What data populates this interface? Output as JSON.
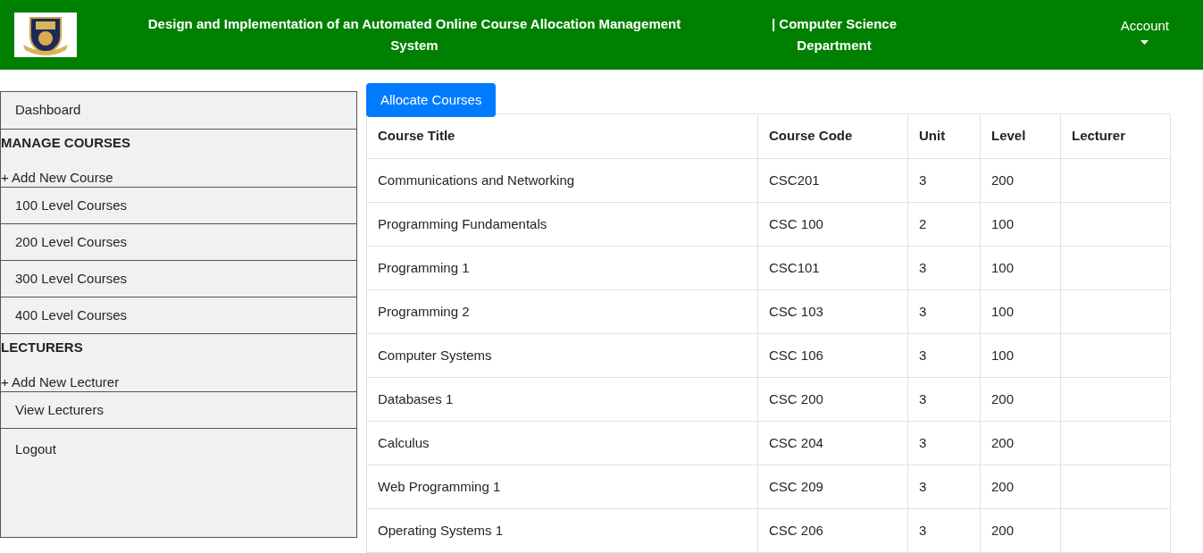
{
  "header": {
    "title": "Design and Implementation of an Automated Online Course Allocation Management System",
    "department": "| Computer Science Department",
    "account": "Account"
  },
  "sidebar": {
    "items": [
      {
        "kind": "link",
        "label": "Dashboard"
      },
      {
        "kind": "section",
        "label": "MANAGE COURSES",
        "add": "+ Add New Course"
      },
      {
        "kind": "link",
        "label": "100 Level Courses"
      },
      {
        "kind": "link",
        "label": "200 Level Courses"
      },
      {
        "kind": "link",
        "label": "300 Level Courses"
      },
      {
        "kind": "link",
        "label": "400 Level Courses"
      },
      {
        "kind": "section",
        "label": "LECTURERS",
        "add": "+ Add New Lecturer"
      },
      {
        "kind": "link",
        "label": "View Lecturers"
      },
      {
        "kind": "last",
        "label": "Logout"
      }
    ]
  },
  "allocate_button": "Allocate Courses",
  "table": {
    "columns": [
      "Course Title",
      "Course Code",
      "Unit",
      "Level",
      "Lecturer"
    ],
    "rows": [
      [
        "Communications and Networking",
        "CSC201",
        "3",
        "200"
      ],
      [
        "Programming Fundamentals",
        "CSC 100",
        "2",
        "100"
      ],
      [
        "Programming 1",
        "CSC101",
        "3",
        "100"
      ],
      [
        "Programming 2",
        "CSC 103",
        "3",
        "100"
      ],
      [
        "Computer Systems",
        "CSC 106",
        "3",
        "100"
      ],
      [
        "Databases 1",
        "CSC 200",
        "3",
        "200"
      ],
      [
        "Calculus",
        "CSC 204",
        "3",
        "200"
      ],
      [
        "Web Programming 1",
        "CSC 209",
        "3",
        "200"
      ],
      [
        "Operating Systems 1",
        "CSC 206",
        "3",
        "200"
      ]
    ]
  }
}
